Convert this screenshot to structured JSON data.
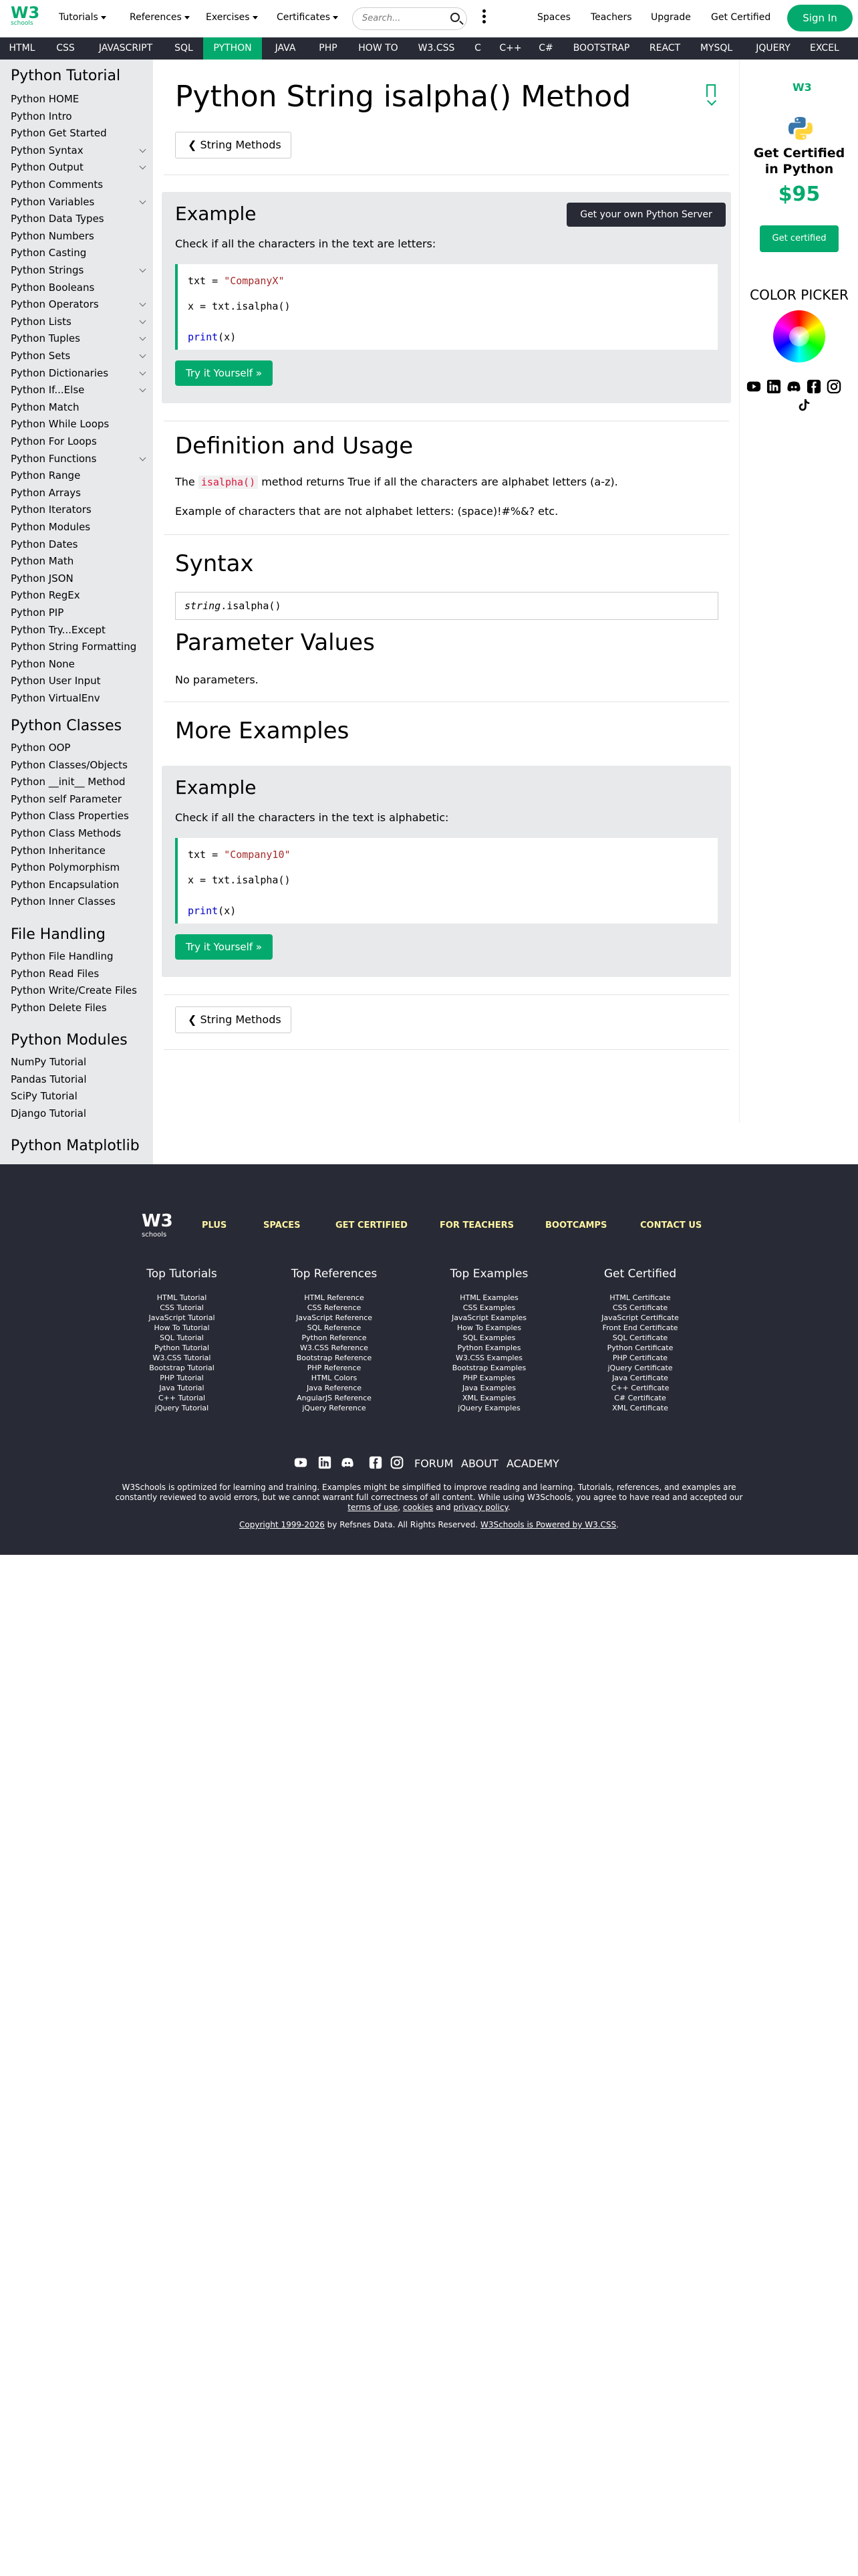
{
  "header": {
    "logo_text": "W3",
    "logo_sub": "schools",
    "menus": [
      "Tutorials",
      "References",
      "Exercises",
      "Certificates"
    ],
    "search_placeholder": "Search...",
    "links": [
      "Spaces",
      "Teachers",
      "Upgrade",
      "Get Certified"
    ],
    "signin": "Sign In"
  },
  "tutorial_nav": [
    "HTML",
    "CSS",
    "JAVASCRIPT",
    "SQL",
    "PYTHON",
    "JAVA",
    "PHP",
    "HOW TO",
    "W3.CSS",
    "C",
    "C++",
    "C#",
    "BOOTSTRAP",
    "REACT",
    "MYSQL",
    "JQUERY",
    "EXCEL"
  ],
  "tutorial_nav_active": "PYTHON",
  "sidebar": {
    "section_tutorial": "Python Tutorial",
    "tutorial_items": [
      "Python HOME",
      "Python Intro",
      "Python Get Started",
      "Python Syntax",
      "Python Output",
      "Python Comments",
      "Python Variables",
      "Python Data Types",
      "Python Numbers",
      "Python Casting",
      "Python Strings",
      "Python Booleans",
      "Python Operators",
      "Python Lists",
      "Python Tuples",
      "Python Sets",
      "Python Dictionaries",
      "Python If...Else",
      "Python Match",
      "Python While Loops",
      "Python For Loops",
      "Python Functions",
      "Python Range",
      "Python Arrays",
      "Python Iterators",
      "Python Modules",
      "Python Dates",
      "Python Math",
      "Python JSON",
      "Python RegEx",
      "Python PIP",
      "Python Try...Except",
      "Python String Formatting",
      "Python None",
      "Python User Input",
      "Python VirtualEnv"
    ],
    "section_classes": "Python Classes",
    "classes_items": [
      "Python OOP",
      "Python Classes/Objects",
      "Python __init__ Method",
      "Python self Parameter",
      "Python Class Properties",
      "Python Class Methods",
      "Python Inheritance",
      "Python Polymorphism",
      "Python Encapsulation",
      "Python Inner Classes"
    ],
    "section_files": "File Handling",
    "files_items": [
      "Python File Handling",
      "Python Read Files",
      "Python Write/Create Files",
      "Python Delete Files"
    ],
    "section_modules": "Python Modules",
    "modules_items": [
      "NumPy Tutorial",
      "Pandas Tutorial",
      "SciPy Tutorial",
      "Django Tutorial"
    ],
    "section_matplotlib": "Python Matplotlib"
  },
  "main": {
    "title": "Python String isalpha() Method",
    "back_button": "String Methods",
    "example1": {
      "heading": "Example",
      "server_button": "Get your own Python Server",
      "description": "Check if all the characters in the text are letters:",
      "code": {
        "l1_pre": "txt = ",
        "l1_str": "\"CompanyX\"",
        "l2": "x = txt.isalpha()",
        "l3_kw": "print",
        "l3_rest": "(x)"
      },
      "try_button": "Try it Yourself »"
    },
    "definition": {
      "heading": "Definition and Usage",
      "p1_pre": "The ",
      "p1_code": "isalpha()",
      "p1_post": " method returns True if all the characters are alphabet letters (a-z).",
      "p2": "Example of characters that are not alphabet letters: (space)!#%&? etc."
    },
    "syntax": {
      "heading": "Syntax",
      "var": "string",
      "method": ".isalpha()"
    },
    "params": {
      "heading": "Parameter Values",
      "text": "No parameters."
    },
    "more": {
      "heading": "More Examples"
    },
    "example2": {
      "heading": "Example",
      "description": "Check if all the characters in the text is alphabetic:",
      "code": {
        "l1_pre": "txt = ",
        "l1_str": "\"Company10\"",
        "l2": "x = txt.isalpha()",
        "l3_kw": "print",
        "l3_rest": "(x)"
      },
      "try_button": "Try it Yourself »"
    },
    "back_button_bottom": "String Methods"
  },
  "right": {
    "brand": "W3",
    "cert_text": "Get Certified in Python",
    "price": "$95",
    "cert_button": "Get certified",
    "picker_title": "COLOR PICKER"
  },
  "footer": {
    "logo_text": "W3",
    "logo_sub": "schools",
    "top_links": [
      "PLUS",
      "SPACES",
      "GET CERTIFIED",
      "FOR TEACHERS",
      "BOOTCAMPS",
      "CONTACT US"
    ],
    "columns": [
      {
        "title": "Top Tutorials",
        "links": [
          "HTML Tutorial",
          "CSS Tutorial",
          "JavaScript Tutorial",
          "How To Tutorial",
          "SQL Tutorial",
          "Python Tutorial",
          "W3.CSS Tutorial",
          "Bootstrap Tutorial",
          "PHP Tutorial",
          "Java Tutorial",
          "C++ Tutorial",
          "jQuery Tutorial"
        ]
      },
      {
        "title": "Top References",
        "links": [
          "HTML Reference",
          "CSS Reference",
          "JavaScript Reference",
          "SQL Reference",
          "Python Reference",
          "W3.CSS Reference",
          "Bootstrap Reference",
          "PHP Reference",
          "HTML Colors",
          "Java Reference",
          "AngularJS Reference",
          "jQuery Reference"
        ]
      },
      {
        "title": "Top Examples",
        "links": [
          "HTML Examples",
          "CSS Examples",
          "JavaScript Examples",
          "How To Examples",
          "SQL Examples",
          "Python Examples",
          "W3.CSS Examples",
          "Bootstrap Examples",
          "PHP Examples",
          "Java Examples",
          "XML Examples",
          "jQuery Examples"
        ]
      },
      {
        "title": "Get Certified",
        "links": [
          "HTML Certificate",
          "CSS Certificate",
          "JavaScript Certificate",
          "Front End Certificate",
          "SQL Certificate",
          "Python Certificate",
          "PHP Certificate",
          "jQuery Certificate",
          "Java Certificate",
          "C++ Certificate",
          "C# Certificate",
          "XML Certificate"
        ]
      }
    ],
    "bottom_words": [
      "FORUM",
      "ABOUT",
      "ACADEMY"
    ],
    "note_l1": "W3Schools is optimized for learning and training. Examples might be simplified to improve reading and learning. Tutorials, references, and examples are",
    "note_l2": "constantly reviewed to avoid errors, but we cannot warrant full correctness of all content. While using W3Schools, you agree to have read and accepted our",
    "note_terms": "terms of use",
    "note_sep1": ", ",
    "note_cookies": "cookies",
    "note_and": " and ",
    "note_privacy": "privacy policy",
    "note_end": ".",
    "copy_link": "Copyright 1999-2026",
    "copy_mid": " by Refsnes Data. All Rights Reserved. ",
    "copy_powered": "W3Schools is Powered by W3.CSS",
    "copy_end": "."
  },
  "colors": {
    "accent": "#04AA6D",
    "dark": "#282A35",
    "sidebar_bg": "#E7E9EB",
    "footer_link": "#FFF4A3"
  }
}
